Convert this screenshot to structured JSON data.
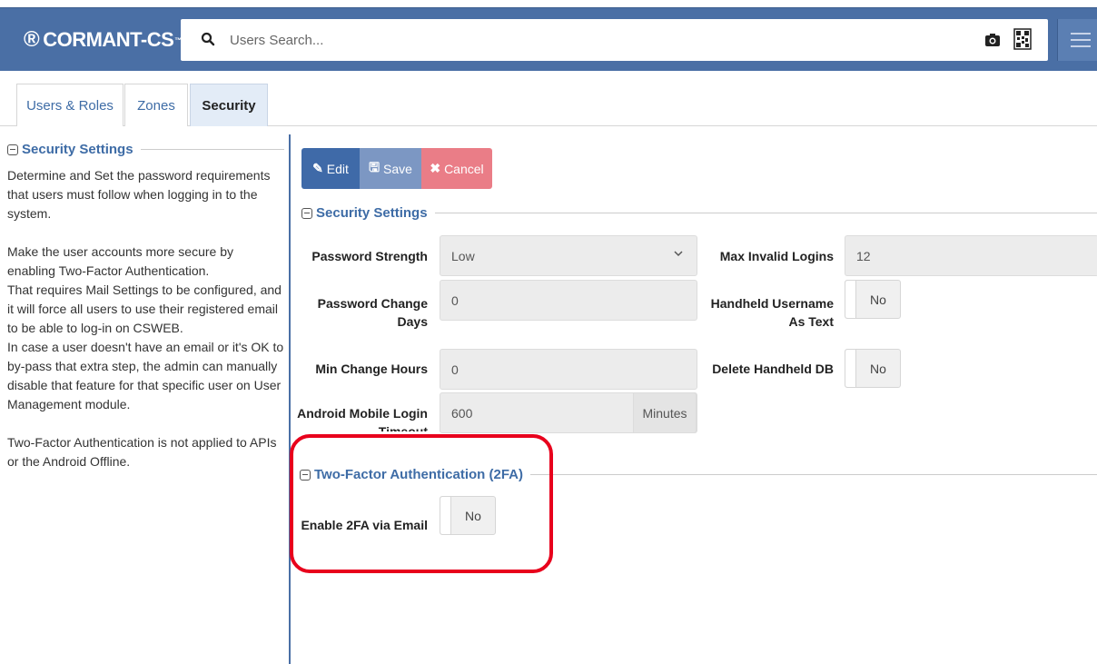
{
  "header": {
    "brand": "CORMANT-CS",
    "brand_mark": "®",
    "search_placeholder": "Users Search..."
  },
  "tabs": [
    {
      "label": "Users & Roles",
      "active": false
    },
    {
      "label": "Zones",
      "active": false
    },
    {
      "label": "Security",
      "active": true
    }
  ],
  "sidebar": {
    "title": "Security Settings",
    "paragraphs": [
      "Determine and Set the password requirements that users must follow when logging in to the system.",
      "Make the user accounts more secure by enabling Two-Factor Authentication.",
      "That requires Mail Settings to be configured, and it will force all users to use their registered email to be able to log-in on CSWEB.",
      "In case a user doesn't have an email or it's OK to by-pass that extra step, the admin can manually disable that feature for that specific user on User Management module.",
      "Two-Factor Authentication is not applied to APIs or the Android Offline."
    ]
  },
  "toolbar": {
    "edit_label": "Edit",
    "save_label": "Save",
    "cancel_label": "Cancel"
  },
  "security_settings": {
    "title": "Security Settings",
    "password_strength": {
      "label": "Password Strength",
      "value": "Low"
    },
    "password_change_days": {
      "label": "Password Change Days",
      "value": "0"
    },
    "min_change_hours": {
      "label": "Min Change Hours",
      "value": "0"
    },
    "android_login_timeout": {
      "label": "Android Mobile Login Timeout",
      "value": "600",
      "unit": "Minutes"
    },
    "max_invalid_logins": {
      "label": "Max Invalid Logins",
      "value": "12"
    },
    "handheld_username_as_text": {
      "label": "Handheld Username As Text",
      "value": "No"
    },
    "delete_handheld_db": {
      "label": "Delete Handheld DB",
      "value": "No"
    }
  },
  "two_factor": {
    "title": "Two-Factor Authentication (2FA)",
    "enable_via_email": {
      "label": "Enable 2FA via Email",
      "value": "No"
    }
  },
  "colors": {
    "header_bg": "#4a6fa5",
    "accent": "#3e6ca6",
    "edit_btn": "#3f6aa8",
    "save_btn": "#7c97c3",
    "cancel_btn": "#ea7d87",
    "highlight": "#e8001c"
  }
}
